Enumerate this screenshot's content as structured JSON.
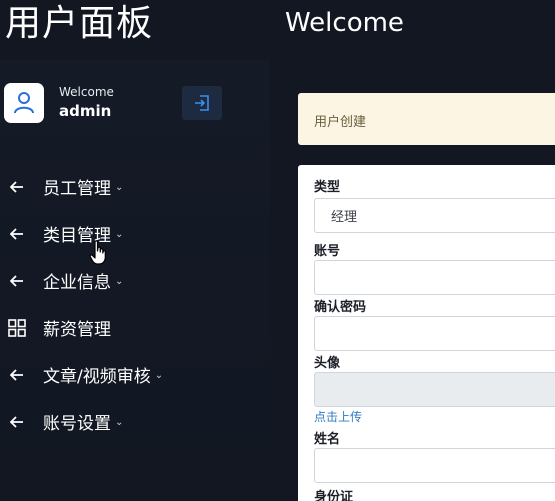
{
  "app_title": "用户面板",
  "header": {
    "title": "Welcome"
  },
  "user": {
    "greeting": "Welcome",
    "name": "admin"
  },
  "sidebar": {
    "items": [
      {
        "label": "员工管理",
        "icon": "arrow-left-icon",
        "has_submenu": true
      },
      {
        "label": "类目管理",
        "icon": "arrow-left-icon",
        "has_submenu": true
      },
      {
        "label": "企业信息",
        "icon": "arrow-left-icon",
        "has_submenu": true
      },
      {
        "label": "薪资管理",
        "icon": "grid-icon",
        "has_submenu": false
      },
      {
        "label": "文章/视频审核",
        "icon": "arrow-left-icon",
        "has_submenu": true
      },
      {
        "label": "账号设置",
        "icon": "arrow-left-icon",
        "has_submenu": true
      }
    ]
  },
  "notice": {
    "text": "用户创建"
  },
  "form": {
    "type_label": "类型",
    "type_value": "经理",
    "account_label": "账号",
    "account_value": "",
    "confirm_password_label": "确认密码",
    "confirm_password_value": "",
    "avatar_label": "头像",
    "avatar_value": "",
    "upload_link": "点击上传",
    "name_label": "姓名",
    "name_value": "",
    "id_card_label": "身份证"
  },
  "colors": {
    "background": "#121722",
    "notice_bg": "#fcf5e3",
    "link": "#2f7bc0",
    "logout_bg": "#1d2a40"
  }
}
